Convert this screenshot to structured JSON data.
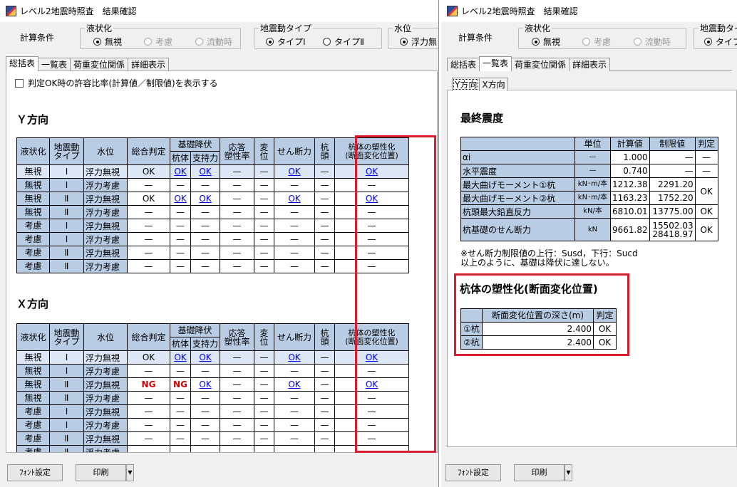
{
  "left": {
    "title": "レベル2地震時照査　結果確認",
    "calc_label": "計算条件",
    "liq": {
      "title": "液状化",
      "opts": [
        "無視",
        "考慮",
        "流動時"
      ]
    },
    "motion": {
      "title": "地震動タイプ",
      "opts": [
        "タイプⅠ",
        "タイプⅡ"
      ]
    },
    "water": {
      "title": "水位",
      "opt": "浮力無"
    },
    "tabs": [
      "総括表",
      "一覧表",
      "荷重変位関係",
      "詳細表示"
    ],
    "checkbox": "判定OK時の許容比率(計算値／制限値)を表示する",
    "y_title": "Ｙ方向",
    "x_title": "Ｘ方向",
    "h1": [
      "液状化",
      "地震動\nタイプ",
      "水位",
      "総合判定",
      "基礎降伏",
      "応答\n塑性率",
      "変位",
      "せん断力",
      "杭頭",
      "杭体の塑性化\n(断面変化位置)"
    ],
    "h2": [
      "杭体",
      "支持力"
    ],
    "y_rows": [
      [
        "無視",
        "Ⅰ",
        "浮力無視",
        "OK",
        "OK",
        "OK",
        "—",
        "—",
        "OK",
        "—",
        "OK"
      ],
      [
        "無視",
        "Ⅰ",
        "浮力考慮",
        "—",
        "—",
        "—",
        "—",
        "—",
        "—",
        "—",
        "—"
      ],
      [
        "無視",
        "Ⅱ",
        "浮力無視",
        "OK",
        "OK",
        "OK",
        "—",
        "—",
        "OK",
        "—",
        "OK"
      ],
      [
        "無視",
        "Ⅱ",
        "浮力考慮",
        "—",
        "—",
        "—",
        "—",
        "—",
        "—",
        "—",
        "—"
      ],
      [
        "考慮",
        "Ⅰ",
        "浮力無視",
        "—",
        "—",
        "—",
        "—",
        "—",
        "—",
        "—",
        "—"
      ],
      [
        "考慮",
        "Ⅰ",
        "浮力考慮",
        "—",
        "—",
        "—",
        "—",
        "—",
        "—",
        "—",
        "—"
      ],
      [
        "考慮",
        "Ⅱ",
        "浮力無視",
        "—",
        "—",
        "—",
        "—",
        "—",
        "—",
        "—",
        "—"
      ],
      [
        "考慮",
        "Ⅱ",
        "浮力考慮",
        "—",
        "—",
        "—",
        "—",
        "—",
        "—",
        "—",
        "—"
      ]
    ],
    "x_rows": [
      [
        "無視",
        "Ⅰ",
        "浮力無視",
        "OK",
        "OK",
        "OK",
        "—",
        "—",
        "OK",
        "—",
        "OK"
      ],
      [
        "無視",
        "Ⅰ",
        "浮力考慮",
        "—",
        "—",
        "—",
        "—",
        "—",
        "—",
        "—",
        "—"
      ],
      [
        "無視",
        "Ⅱ",
        "浮力無視",
        "NG",
        "NG",
        "OK",
        "—",
        "—",
        "OK",
        "—",
        "OK"
      ],
      [
        "無視",
        "Ⅱ",
        "浮力考慮",
        "—",
        "—",
        "—",
        "—",
        "—",
        "—",
        "—",
        "—"
      ],
      [
        "考慮",
        "Ⅰ",
        "浮力無視",
        "—",
        "—",
        "—",
        "—",
        "—",
        "—",
        "—",
        "—"
      ],
      [
        "考慮",
        "Ⅰ",
        "浮力考慮",
        "—",
        "—",
        "—",
        "—",
        "—",
        "—",
        "—",
        "—"
      ],
      [
        "考慮",
        "Ⅱ",
        "浮力無視",
        "—",
        "—",
        "—",
        "—",
        "—",
        "—",
        "—",
        "—"
      ],
      [
        "考慮",
        "Ⅱ",
        "浮力考慮",
        "—",
        "—",
        "—",
        "—",
        "—",
        "—",
        "—",
        "—"
      ]
    ],
    "font_btn": "ﾌｫﾝﾄ設定",
    "print_btn": "印刷"
  },
  "right": {
    "title": "レベル2地震時照査　結果確認",
    "calc_label": "計算条件",
    "liq": {
      "title": "液状化",
      "opts": [
        "無視",
        "考慮",
        "流動時"
      ]
    },
    "motion": {
      "title": "地震動タイプ",
      "opt": "タイプ"
    },
    "tabs": [
      "総括表",
      "一覧表",
      "荷重変位関係",
      "詳細表示"
    ],
    "subtabs": [
      "Y方向",
      "X方向"
    ],
    "seismic_title": "最終震度",
    "seismic_head": [
      "単位",
      "計算値",
      "制限値",
      "判定"
    ],
    "seismic_rows": [
      {
        "name": "αi",
        "unit": "—",
        "calc": "1.000",
        "limit": "—",
        "judge": "—"
      },
      {
        "name": "水平震度",
        "unit": "—",
        "calc": "0.740",
        "limit": "—",
        "judge": "—"
      },
      {
        "name": "最大曲げモーメント①杭",
        "unit": "kN･m/本",
        "calc": "1212.38",
        "limit": "2291.20",
        "judge": "OK"
      },
      {
        "name": "最大曲げモーメント②杭",
        "unit": "kN･m/本",
        "calc": "1163.23",
        "limit": "1752.20",
        "judge": ""
      },
      {
        "name": "杭頭最大鉛直反力",
        "unit": "kN/本",
        "calc": "6810.01",
        "limit": "13775.00",
        "judge": "OK"
      },
      {
        "name": "杭基礎のせん断力",
        "unit": "kN",
        "calc": "9661.82",
        "limit": "15502.03\n28418.97",
        "judge": "OK"
      }
    ],
    "note1": "※せん断力制限値の上行：Susd，下行：Sucd",
    "note2": "以上のように、基礎は降伏に達しない。",
    "plastic_title": "杭体の塑性化(断面変化位置)",
    "plastic_head": [
      "断面変化位置の深さ(m)",
      "判定"
    ],
    "plastic_rows": [
      {
        "name": "①杭",
        "depth": "2.400",
        "judge": "OK"
      },
      {
        "name": "②杭",
        "depth": "2.400",
        "judge": "OK"
      }
    ],
    "font_btn": "ﾌｫﾝﾄ設定",
    "print_btn": "印刷"
  }
}
